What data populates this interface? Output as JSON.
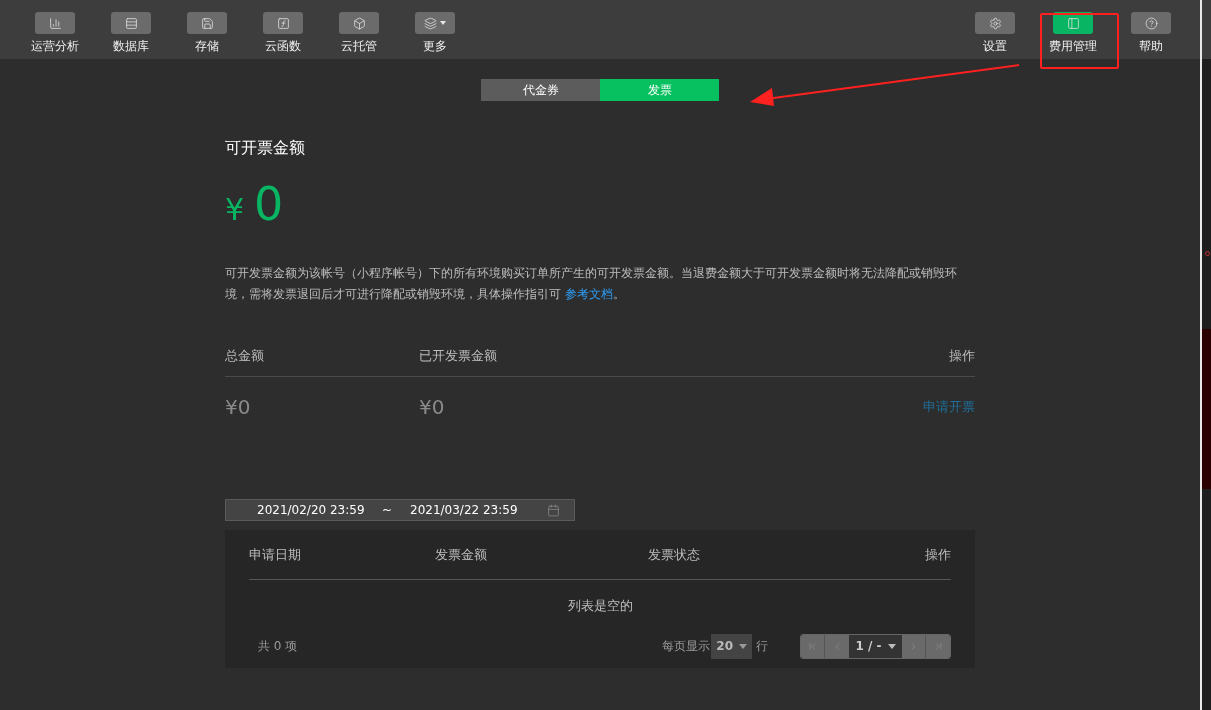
{
  "toolbar": {
    "left": [
      {
        "kind": "chart",
        "label": "运营分析",
        "selected": false
      },
      {
        "kind": "database",
        "label": "数据库",
        "selected": false
      },
      {
        "kind": "storage",
        "label": "存储",
        "selected": false
      },
      {
        "kind": "function",
        "label": "云函数",
        "selected": false
      },
      {
        "kind": "hosting",
        "label": "云托管",
        "selected": false
      },
      {
        "kind": "more",
        "label": "更多",
        "selected": false
      }
    ],
    "right": [
      {
        "kind": "settings",
        "label": "设置",
        "selected": false
      },
      {
        "kind": "billing",
        "label": "费用管理",
        "selected": true
      },
      {
        "kind": "help",
        "label": "帮助",
        "selected": false
      }
    ]
  },
  "tabs": [
    {
      "label": "代金券",
      "selected": false
    },
    {
      "label": "发票",
      "selected": true
    }
  ],
  "invoice": {
    "title": "可开票金额",
    "currency": "¥",
    "amount": "0",
    "note": "可开发票金额为该帐号（小程序帐号）下的所有环境购买订单所产生的可开发票金额。当退费金额大于可开发票金额时将无法降配或销毁环境，需将发票退回后才可进行降配或销毁环境，具体操作指引可 ",
    "link": "参考文档",
    "note_end": "。",
    "columns": [
      "总金额",
      "已开发票金额",
      "操作"
    ],
    "values": [
      "¥0",
      "¥0"
    ],
    "action": "申请开票"
  },
  "date_range": {
    "start": "2021/02/20 23:59",
    "separator": "~",
    "end": "2021/03/22 23:59"
  },
  "table": {
    "columns": [
      "申请日期",
      "发票金额",
      "发票状态",
      "操作"
    ],
    "empty": "列表是空的",
    "total": "共 0 项",
    "per_page_label": "每页显示",
    "per_page": "20",
    "rows_label": "行",
    "page": "1 / -"
  }
}
